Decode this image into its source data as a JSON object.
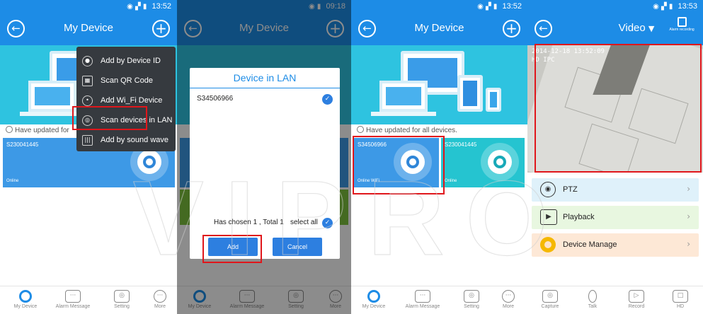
{
  "colors": {
    "primary": "#1d8ce6",
    "banner": "#2ec3e0",
    "card_blue": "#3d99e6",
    "card_cyan": "#25c4d0",
    "highlight": "#e0161b",
    "menu_bg": "#363a3f",
    "ptz_row": "#dff1fa",
    "playback_row": "#e8f7e0",
    "manage_row": "#fde8d6"
  },
  "panel1": {
    "status_time": "13:52",
    "title": "My Device",
    "updated_text": "Have updated for",
    "device_id": "S230041445",
    "device_status": "Online",
    "menu": [
      {
        "icon": "magnifier-device-icon",
        "label": "Add by Device ID"
      },
      {
        "icon": "qr-code-icon",
        "label": "Scan QR Code"
      },
      {
        "icon": "wifi-broadcast-icon",
        "label": "Add Wi_Fi Device"
      },
      {
        "icon": "radar-scan-icon",
        "label": "Scan devices in LAN"
      },
      {
        "icon": "sound-wave-icon",
        "label": "Add by sound wave"
      }
    ],
    "tabs": [
      {
        "icon": "my-device-icon",
        "label": "My Device"
      },
      {
        "icon": "alarm-message-icon",
        "label": "Alarm Message"
      },
      {
        "icon": "setting-icon",
        "label": "Setting"
      },
      {
        "icon": "more-icon",
        "label": "More"
      }
    ]
  },
  "panel2": {
    "status_time": "09:18",
    "title": "My Device",
    "dialog_title": "Device in LAN",
    "lan_device": "S34506966",
    "chosen_text": "Has chosen 1 , Total 1",
    "select_all": "select all",
    "add_button": "Add",
    "cancel_button": "Cancel",
    "tabs": [
      "My Device",
      "Alarm Message",
      "Setting",
      "More"
    ]
  },
  "panel3": {
    "status_time": "13:52",
    "title": "My Device",
    "updated_text": "Have updated for all devices.",
    "devices": [
      {
        "id": "S34506966",
        "status": "Online WiFi"
      },
      {
        "id": "S230041445",
        "status": "Online"
      }
    ],
    "tabs": [
      "My Device",
      "Alarm Message",
      "Setting",
      "More"
    ]
  },
  "panel4": {
    "status_time": "13:53",
    "title": "Video",
    "alarm_label": "Alarm recording",
    "video_timestamp": "2014-12-18 13:52:09",
    "video_channel": "HD IPC",
    "menu": [
      {
        "icon": "ptz-control-icon",
        "label": "PTZ"
      },
      {
        "icon": "playback-icon",
        "label": "Playback"
      },
      {
        "icon": "device-manage-icon",
        "label": "Device Manage"
      }
    ],
    "tabs": [
      {
        "icon": "camera-capture-icon",
        "label": "Capture"
      },
      {
        "icon": "microphone-icon",
        "label": "Talk"
      },
      {
        "icon": "video-record-icon",
        "label": "Record"
      },
      {
        "icon": "hd-icon",
        "label": "HD"
      }
    ]
  },
  "watermark": "VIPRO"
}
